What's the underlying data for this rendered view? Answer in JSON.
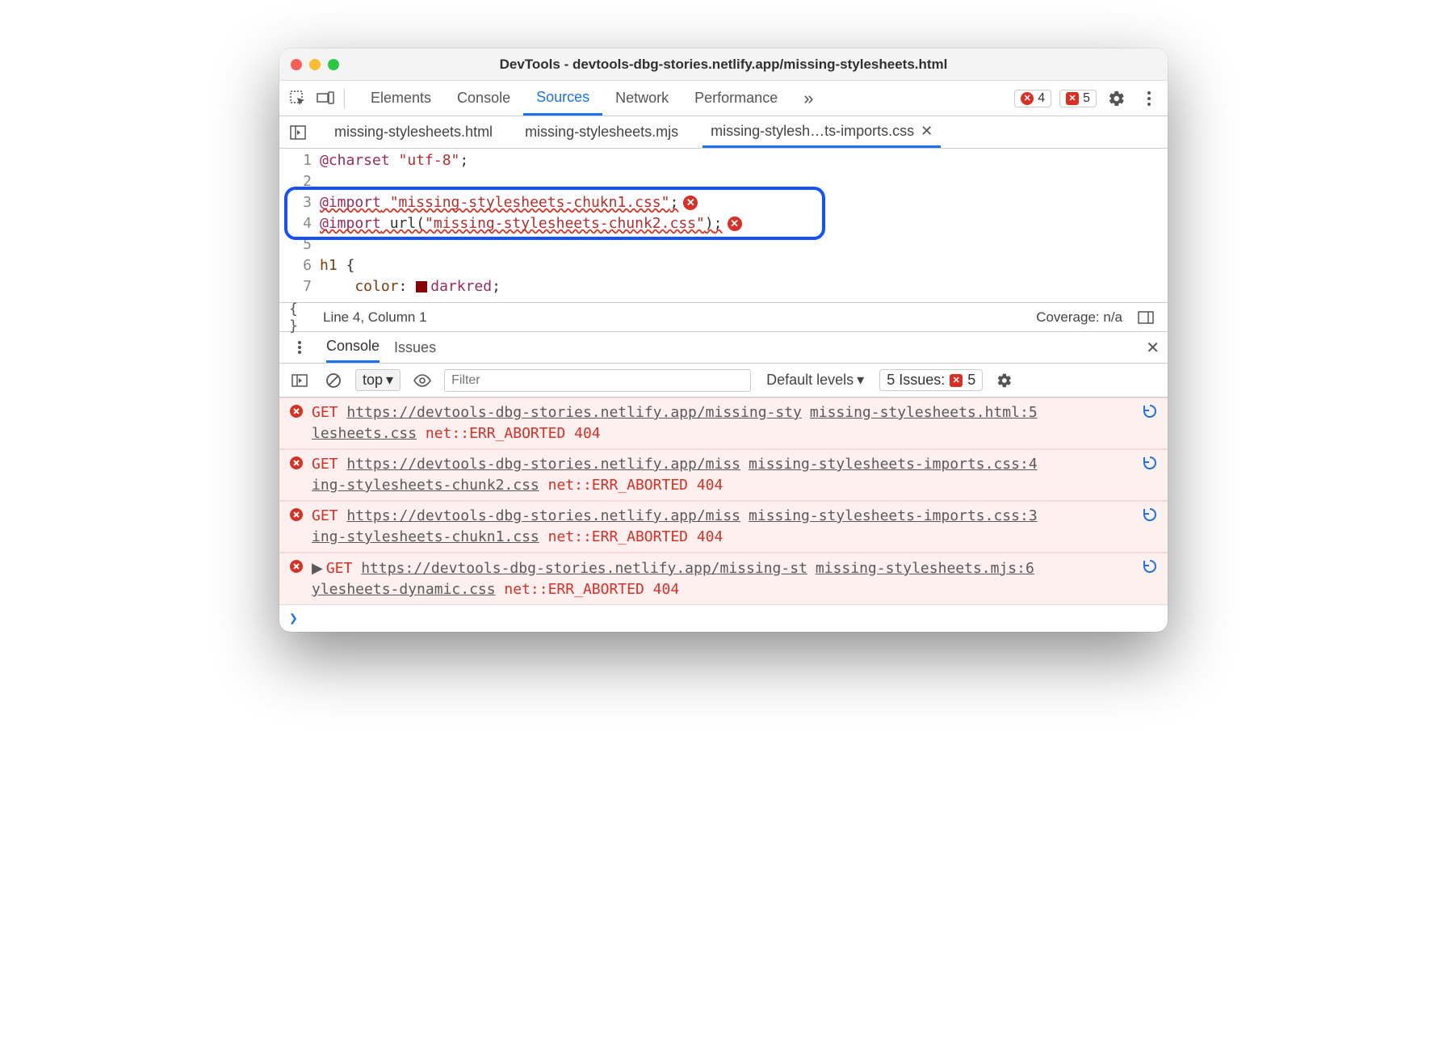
{
  "window": {
    "title": "DevTools - devtools-dbg-stories.netlify.app/missing-stylesheets.html"
  },
  "panels": {
    "elements": "Elements",
    "console": "Console",
    "sources": "Sources",
    "network": "Network",
    "performance": "Performance",
    "more": "»"
  },
  "badges": {
    "errors": "4",
    "issues": "5"
  },
  "file_tabs": {
    "t0": "missing-stylesheets.html",
    "t1": "missing-stylesheets.mjs",
    "t2": "missing-stylesh…ts-imports.css"
  },
  "code": {
    "l1_kw": "@charset",
    "l1_str": " \"utf-8\"",
    "l1_semi": ";",
    "l3_kw": "@import",
    "l3_str": " \"missing-stylesheets-chukn1.css\"",
    "l3_semi": ";",
    "l4_kw": "@import",
    "l4_fn": " url(",
    "l4_str": "\"missing-stylesheets-chunk2.css\"",
    "l4_cl": ")",
    "l4_semi": ";",
    "l6_sel": "h1 ",
    "l6_brace": "{",
    "l7_prop": "    color",
    "l7_colon": ": ",
    "l7_val": "darkred",
    "l7_semi": ";"
  },
  "status": {
    "pos": "Line 4, Column 1",
    "coverage": "Coverage: n/a"
  },
  "drawer": {
    "console": "Console",
    "issues": "Issues"
  },
  "console_toolbar": {
    "context": "top",
    "filter_ph": "Filter",
    "levels": "Default levels",
    "issues_label": "5 Issues:",
    "issues_count": "5"
  },
  "messages": [
    {
      "method": "GET",
      "url_a": "https://devtools-dbg-stories.netlify.app/missing-sty",
      "url_b": "lesheets.css",
      "err": " net::ERR_ABORTED 404",
      "src": "missing-stylesheets.html:5",
      "expand": false
    },
    {
      "method": "GET",
      "url_a": "https://devtools-dbg-stories.netlify.app/miss",
      "url_b": "ing-stylesheets-chunk2.css",
      "err": " net::ERR_ABORTED 404",
      "src": "missing-stylesheets-imports.css:4",
      "expand": false
    },
    {
      "method": "GET",
      "url_a": "https://devtools-dbg-stories.netlify.app/miss",
      "url_b": "ing-stylesheets-chukn1.css",
      "err": " net::ERR_ABORTED 404",
      "src": "missing-stylesheets-imports.css:3",
      "expand": false
    },
    {
      "method": "GET",
      "url_a": "https://devtools-dbg-stories.netlify.app/missing-st",
      "url_b": "ylesheets-dynamic.css",
      "err": " net::ERR_ABORTED 404",
      "src": "missing-stylesheets.mjs:6",
      "expand": true
    }
  ]
}
